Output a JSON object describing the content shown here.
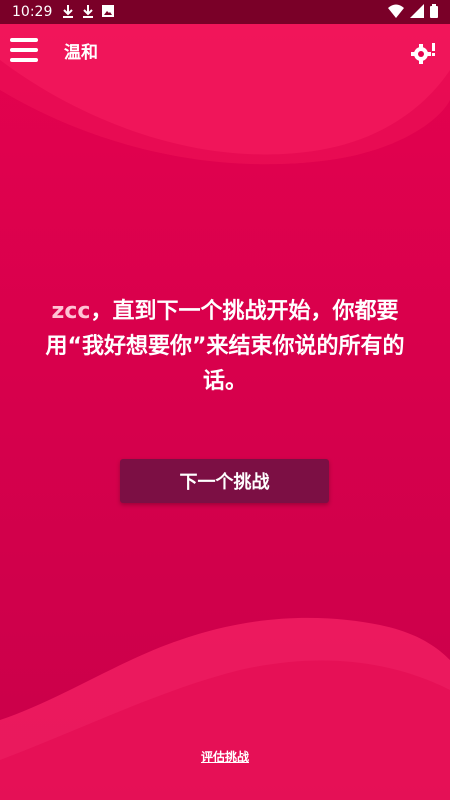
{
  "status_bar": {
    "time": "10:29",
    "left_icons": [
      "download-icon",
      "download-icon",
      "image-icon"
    ],
    "right_icons": [
      "wifi-icon",
      "signal-icon",
      "battery-icon"
    ]
  },
  "app_bar": {
    "title": "温和",
    "menu_icon": "hamburger-menu-icon",
    "settings_icon": "settings-alert-icon"
  },
  "challenge": {
    "player_name": "zcc",
    "text_after_name": "，直到下一个挑战开始，你都要用“我好想要你”来结束你说的所有的话。"
  },
  "next_button": {
    "label": "下一个挑战"
  },
  "rate_link": {
    "label": "评估挑战"
  },
  "colors": {
    "background": "#d8004c",
    "status_bar": "#7a0028",
    "button": "#7c0f44",
    "name_highlight": "#ffc3d4"
  }
}
